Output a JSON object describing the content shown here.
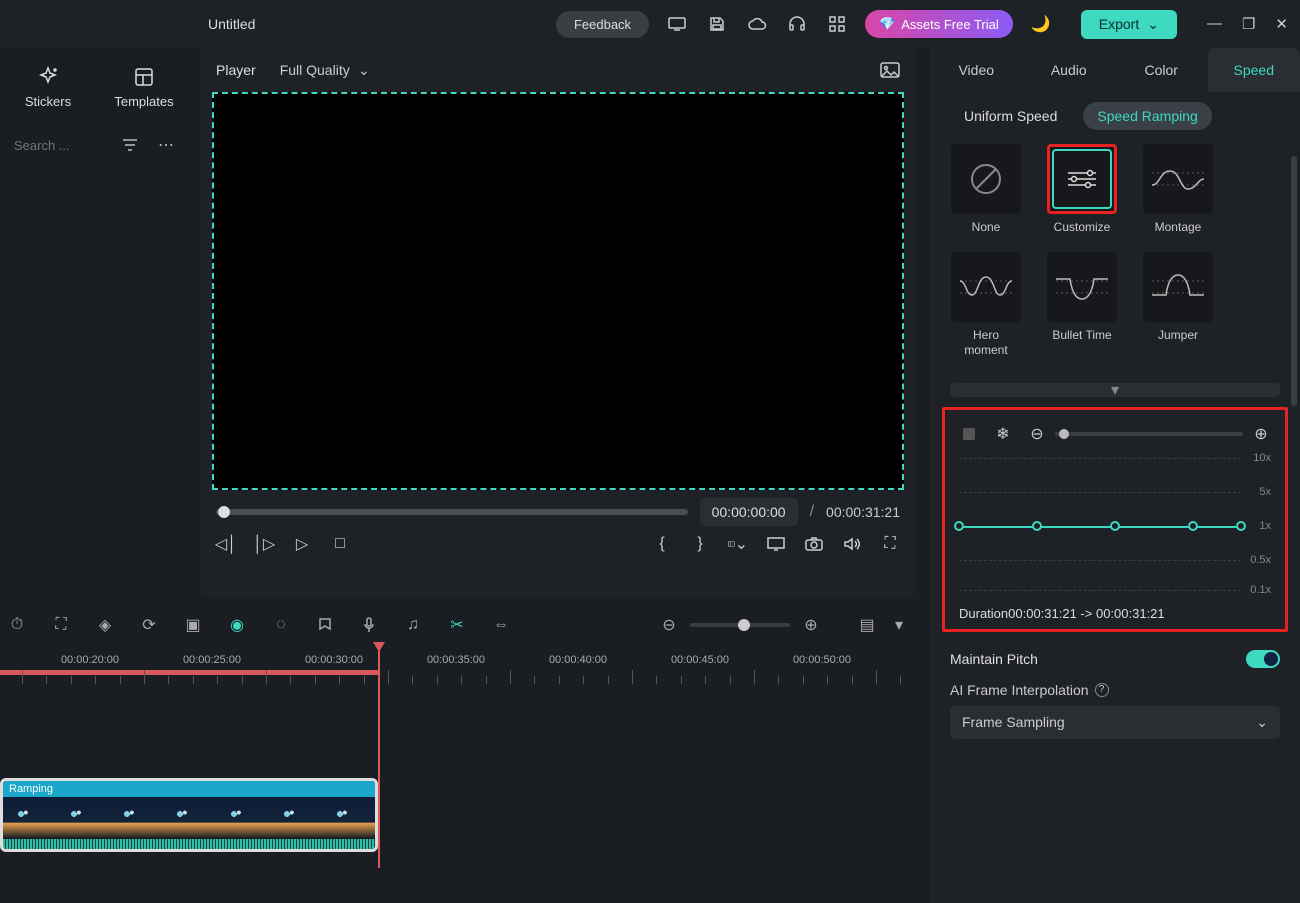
{
  "topbar": {
    "title": "Untitled",
    "feedback": "Feedback",
    "assets_trial": "Assets Free Trial",
    "export": "Export"
  },
  "library": {
    "tabs": {
      "stickers": "Stickers",
      "templates": "Templates"
    },
    "search_placeholder": "Search ..."
  },
  "preview": {
    "player_label": "Player",
    "quality": "Full Quality",
    "time_current": "00:00:00:00",
    "time_sep": "/",
    "time_total": "00:00:31:21"
  },
  "properties": {
    "tabs": {
      "video": "Video",
      "audio": "Audio",
      "color": "Color",
      "speed": "Speed"
    },
    "speed": {
      "subtabs": {
        "uniform": "Uniform Speed",
        "ramping": "Speed Ramping"
      },
      "presets": {
        "none": "None",
        "customize": "Customize",
        "montage": "Montage",
        "hero": "Hero moment",
        "bullet": "Bullet Time",
        "jumper": "Jumper"
      },
      "graph": {
        "labels": {
          "l10": "10x",
          "l5": "5x",
          "l1": "1x",
          "l05": "0.5x",
          "l01": "0.1x"
        }
      },
      "duration_label": "Duration",
      "duration_value": "00:00:31:21 -> 00:00:31:21",
      "maintain_pitch": "Maintain Pitch",
      "ai_interp": "AI Frame Interpolation",
      "frame_sampling": "Frame Sampling"
    }
  },
  "timeline": {
    "ruler": [
      "00:00:20:00",
      "00:00:25:00",
      "00:00:30:00",
      "00:00:35:00",
      "00:00:40:00",
      "00:00:45:00",
      "00:00:50:00"
    ],
    "clip_label": "Ramping"
  }
}
